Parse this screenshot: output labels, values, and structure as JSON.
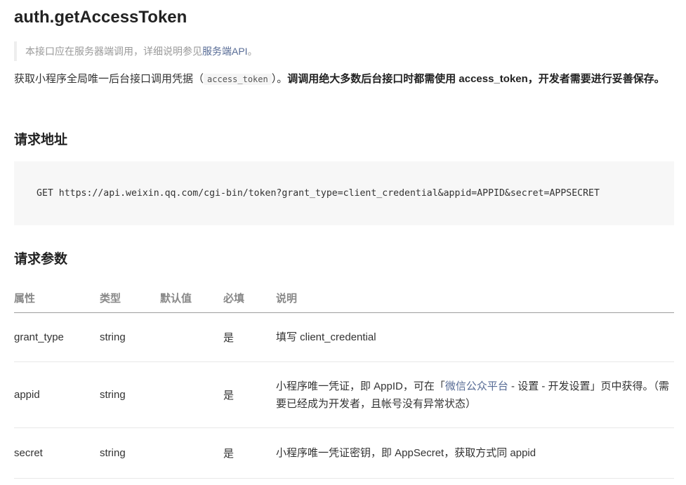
{
  "title": "auth.getAccessToken",
  "note": {
    "text": "本接口应在服务器端调用，详细说明参见",
    "link": "服务端API",
    "end": "。"
  },
  "description": {
    "part1": "获取小程序全局唯一后台接口调用凭据（",
    "code": "access_token",
    "part2": "）。",
    "bold": "调调用绝大多数后台接口时都需使用 access_token，开发者需要进行妥善保存。"
  },
  "request_url": {
    "heading": "请求地址",
    "code": "GET https://api.weixin.qq.com/cgi-bin/token?grant_type=client_credential&appid=APPID&secret=APPSECRET"
  },
  "request_params": {
    "heading": "请求参数",
    "columns": [
      "属性",
      "类型",
      "默认值",
      "必填",
      "说明"
    ],
    "rows": [
      {
        "name": "grant_type",
        "type": "string",
        "default": "",
        "required": "是",
        "desc": "填写 client_credential"
      },
      {
        "name": "appid",
        "type": "string",
        "default": "",
        "required": "是",
        "desc_prefix": "小程序唯一凭证，即 AppID，可在「",
        "desc_link": "微信公众平台",
        "desc_suffix": " - 设置 - 开发设置」页中获得。（需要已经成为开发者，且帐号没有异常状态）"
      },
      {
        "name": "secret",
        "type": "string",
        "default": "",
        "required": "是",
        "desc": "小程序唯一凭证密钥，即 AppSecret，获取方式同 appid"
      }
    ]
  },
  "colors": {
    "link": "#576b95",
    "code_bg": "#f7f7f7",
    "text": "#333333"
  }
}
